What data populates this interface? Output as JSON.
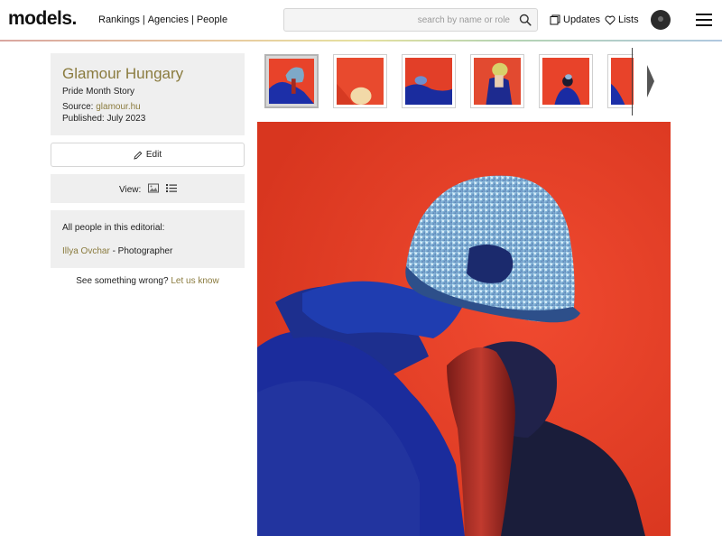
{
  "header": {
    "logo": "models.",
    "nav": [
      "Rankings",
      "Agencies",
      "People"
    ],
    "nav_separator": "|",
    "search_placeholder": "search by name or role",
    "updates_label": "Updates",
    "lists_label": "Lists"
  },
  "editorial": {
    "title": "Glamour Hungary",
    "subtitle": "Pride Month Story",
    "source_label": "Source:",
    "source_link": "glamour.hu",
    "published": "Published: July 2023"
  },
  "actions": {
    "edit_label": "Edit",
    "view_label": "View:"
  },
  "people": {
    "heading": "All people in this editorial:",
    "list": [
      {
        "name": "Illya Ovchar",
        "role": " - Photographer"
      }
    ]
  },
  "report": {
    "text": "See something wrong?",
    "link": "Let us know"
  },
  "colors": {
    "accent": "#8a7b3e",
    "panel": "#efefef",
    "photo_red": "#e8432a",
    "photo_blue": "#1c2fa8"
  }
}
